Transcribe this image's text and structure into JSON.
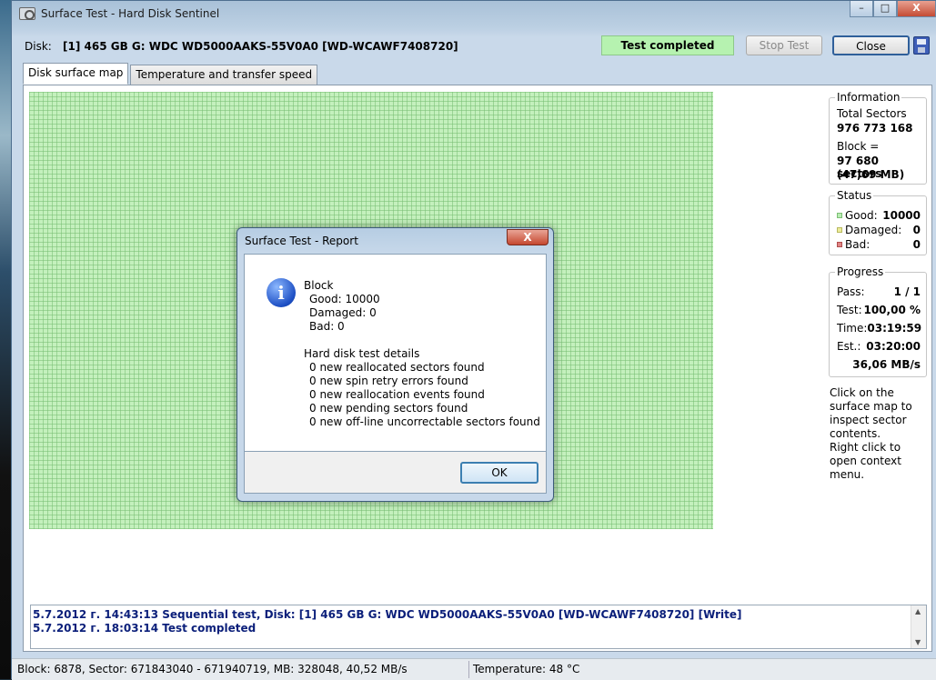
{
  "window": {
    "title": "Surface Test - Hard Disk Sentinel",
    "controls": {
      "minimize": "–",
      "maximize": "□",
      "close": "X"
    }
  },
  "disk": {
    "label": "Disk:",
    "value": "[1] 465 GB G: WDC WD5000AAKS-55V0A0 [WD-WCAWF7408720]"
  },
  "toolbar": {
    "status": "Test completed",
    "stop_label": "Stop Test",
    "close_label": "Close"
  },
  "tabs": [
    {
      "label": "Disk surface map",
      "active": true
    },
    {
      "label": "Temperature and transfer speed",
      "active": false
    }
  ],
  "information": {
    "title": "Information",
    "total_label": "Total Sectors",
    "total_value": "976 773 168",
    "block_label": "Block =",
    "block_sectors": "97 680 sectors",
    "block_mb": "(47,69 MB)"
  },
  "status": {
    "title": "Status",
    "items": [
      {
        "label": "Good:",
        "value": "10000",
        "color": "#b9ecb3"
      },
      {
        "label": "Damaged:",
        "value": "0",
        "color": "#ecec9a"
      },
      {
        "label": "Bad:",
        "value": "0",
        "color": "#e08585"
      }
    ]
  },
  "progress": {
    "title": "Progress",
    "pass_label": "Pass:",
    "pass_value": "1 / 1",
    "test_label": "Test:",
    "test_value": "100,00 %",
    "time_label": "Time:",
    "time_value": "03:19:59",
    "est_label": "Est.:",
    "est_value": "03:20:00",
    "speed": "36,06 MB/s"
  },
  "help": {
    "line1": "Click on the surface map to inspect sector contents.",
    "line2": "Right click to open context menu."
  },
  "log": [
    "5.7.2012 г.  14:43:13   Sequential test, Disk: [1] 465 GB G: WDC WD5000AAKS-55V0A0 [WD-WCAWF7408720] [Write]",
    "5.7.2012 г.  18:03:14   Test completed"
  ],
  "statusbar": {
    "left": "Block: 6878, Sector: 671843040 - 671940719, MB: 328048, 40,52 MB/s",
    "right": "Temperature: 48  °C"
  },
  "report": {
    "title": "Surface Test - Report",
    "close": "X",
    "lines": [
      "Block",
      "  Good: 10000",
      "  Damaged: 0",
      "  Bad: 0",
      "",
      "Hard disk test details",
      "  0 new reallocated sectors found",
      "  0 new spin retry errors found",
      "  0 new reallocation events found",
      "  0 new pending sectors found",
      "  0 new off-line uncorrectable sectors found"
    ],
    "ok_label": "OK",
    "icon": "i"
  }
}
